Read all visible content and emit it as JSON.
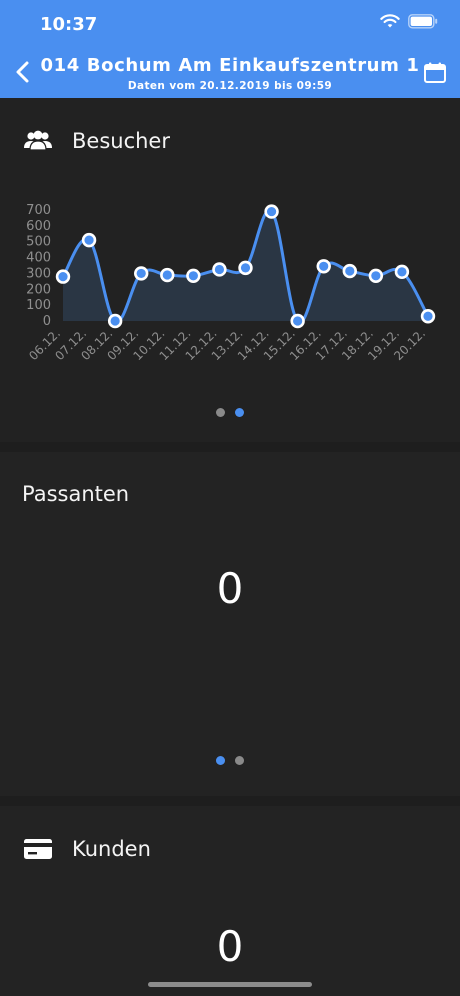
{
  "status": {
    "time": "10:37"
  },
  "nav": {
    "title": "014 Bochum Am Einkaufszentrum 1",
    "subtitle": "Daten vom 20.12.2019 bis 09:59"
  },
  "visitors": {
    "title": "Besucher",
    "icon": "group-icon"
  },
  "passersby": {
    "title": "Passanten",
    "value": "0"
  },
  "customers": {
    "title": "Kunden",
    "icon": "credit-card-icon",
    "value": "0"
  },
  "colors": {
    "accent": "#4a8ff0",
    "background": "#262626",
    "line": "#4a8ff0",
    "fill": "#2c3a4a"
  },
  "chart_data": {
    "type": "area",
    "categories": [
      "06.12.",
      "07.12.",
      "08.12.",
      "09.12.",
      "10.12.",
      "11.12.",
      "12.12.",
      "13.12.",
      "14.12.",
      "15.12.",
      "16.12.",
      "17.12.",
      "18.12.",
      "19.12.",
      "20.12."
    ],
    "values": [
      280,
      510,
      0,
      300,
      290,
      285,
      325,
      335,
      690,
      0,
      345,
      315,
      285,
      310,
      30
    ],
    "yticks": [
      0,
      100,
      200,
      300,
      400,
      500,
      600,
      700
    ],
    "ylim": [
      0,
      700
    ],
    "grid": false,
    "legend": "none"
  }
}
